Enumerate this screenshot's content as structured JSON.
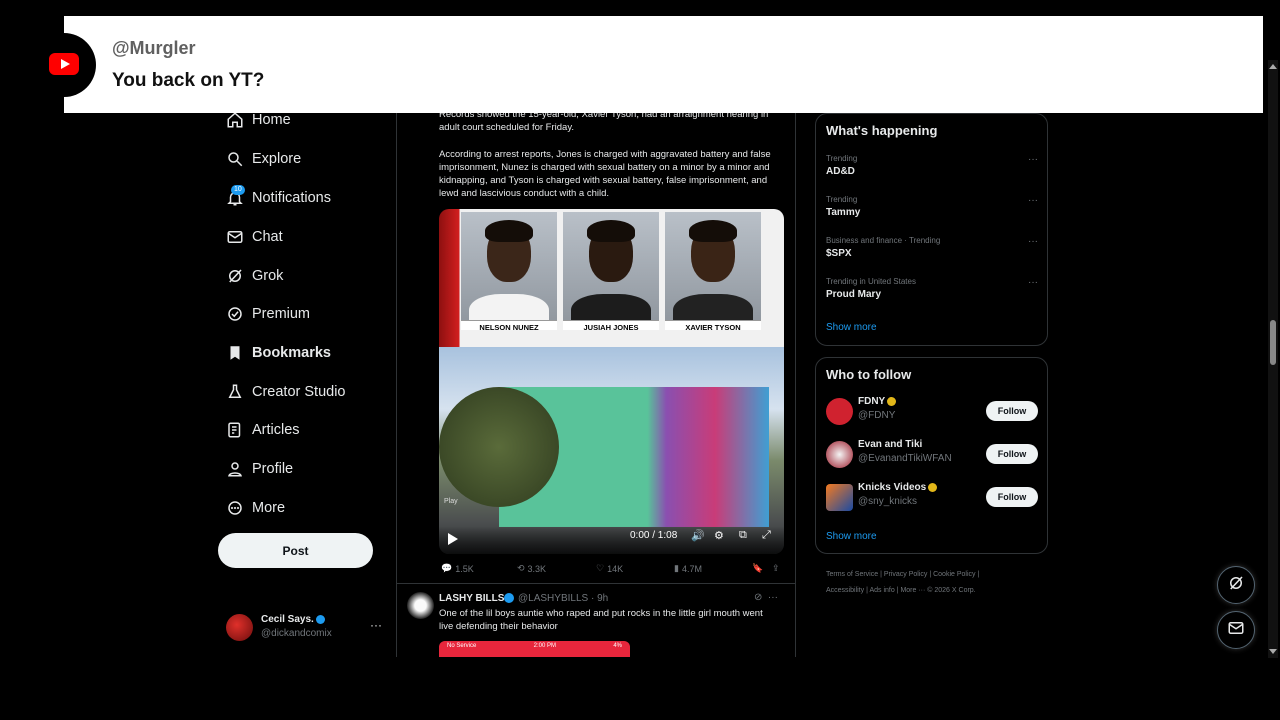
{
  "overlay": {
    "username": "@Murgler",
    "comment": "You back on YT?"
  },
  "nav": {
    "items": [
      {
        "label": "Home",
        "icon": "home-icon"
      },
      {
        "label": "Explore",
        "icon": "search-icon"
      },
      {
        "label": "Notifications",
        "icon": "bell-icon",
        "badge": "10"
      },
      {
        "label": "Chat",
        "icon": "mail-icon"
      },
      {
        "label": "Grok",
        "icon": "grok-icon"
      },
      {
        "label": "Premium",
        "icon": "premium-icon"
      },
      {
        "label": "Bookmarks",
        "icon": "bookmark-icon"
      },
      {
        "label": "Creator Studio",
        "icon": "creator-icon"
      },
      {
        "label": "Articles",
        "icon": "articles-icon"
      },
      {
        "label": "Profile",
        "icon": "person-icon"
      },
      {
        "label": "More",
        "icon": "more-circle-icon"
      }
    ],
    "post_label": "Post"
  },
  "account": {
    "name": "Cecil Says.",
    "handle": "@dickandcomix",
    "more": "···"
  },
  "tweet1": {
    "text_partial": "Records showed the 15-year-old, Xavier Tyson, had an arraignment hearing in adult court scheduled for Friday.",
    "text_2": "According to arrest reports, Jones is charged with aggravated battery and false imprisonment, Nunez is charged with sexual battery on a minor by a minor and kidnapping, and Tyson is charged with sexual battery, false imprisonment, and lewd and lascivious conduct with a child.",
    "mugshots": [
      "NELSON NUNEZ",
      "JUSIAH JONES",
      "XAVIER TYSON"
    ],
    "video_time": "0:00 / 1:08",
    "play_tag": "Play",
    "metrics": {
      "replies": "1.5K",
      "reposts": "3.3K",
      "likes": "14K",
      "views": "4.7M"
    }
  },
  "tweet2": {
    "name": "LASHY BILLS",
    "handle": "@LASHYBILLS · 9h",
    "text": "One of the lil boys auntie who raped and put rocks in the little girl mouth went live defending their behavior",
    "phone_status_left": "No Service",
    "phone_status_time": "2:00 PM",
    "phone_status_right": "4%"
  },
  "trending": {
    "title": "What's happening",
    "items": [
      {
        "meta": "Trending",
        "name": "AD&D"
      },
      {
        "meta": "Trending",
        "name": "Tammy"
      },
      {
        "meta": "Business and finance · Trending",
        "name": "$SPX"
      },
      {
        "meta": "Trending in United States",
        "name": "Proud Mary"
      }
    ],
    "show_more": "Show more"
  },
  "who_to_follow": {
    "title": "Who to follow",
    "items": [
      {
        "name": "FDNY",
        "handle": "@FDNY",
        "button": "Follow"
      },
      {
        "name": "Evan and Tiki",
        "handle": "@EvanandTikiWFAN",
        "button": "Follow"
      },
      {
        "name": "Knicks Videos",
        "handle": "@sny_knicks",
        "button": "Follow"
      }
    ],
    "show_more": "Show more"
  },
  "footer": {
    "line1": "Terms of Service  |  Privacy Policy  |  Cookie Policy  |",
    "line2": "Accessibility  |  Ads info  |  More ···  © 2026 X Corp."
  },
  "colors": {
    "accent": "#1d9bf0",
    "bg": "#000000",
    "yt_red": "#ff0000"
  }
}
